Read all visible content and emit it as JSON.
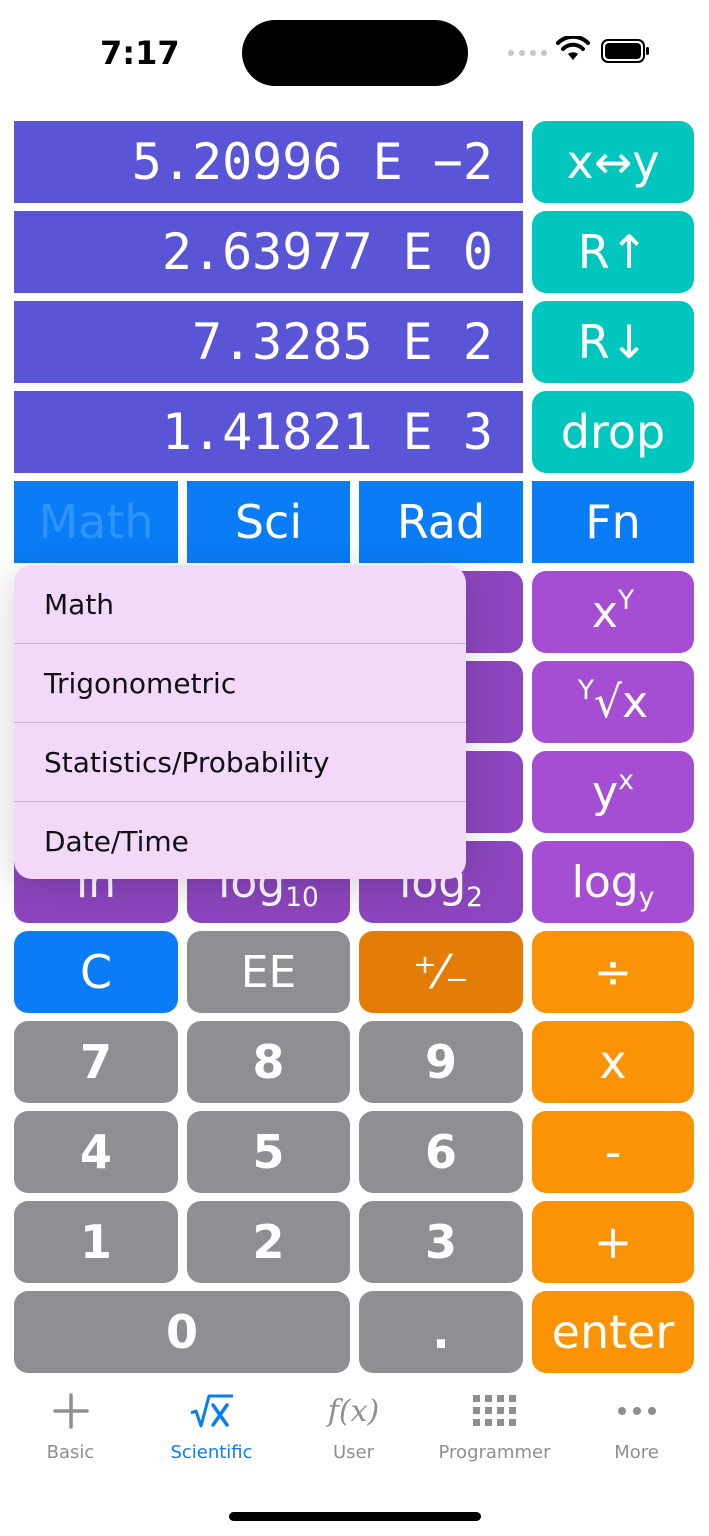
{
  "status": {
    "time": "7:17"
  },
  "stack": [
    "5.20996 E −2",
    "2.63977 E 0",
    "7.3285 E 2",
    "1.41821 E 3"
  ],
  "stack_buttons": [
    "x↔y",
    "R↑",
    "R↓",
    "drop"
  ],
  "modes": [
    "Math",
    "Sci",
    "Rad",
    "Fn"
  ],
  "func_right": {
    "pow_base": "x",
    "pow_exp": "Y",
    "root_index": "Y",
    "root_radicand": "x",
    "ypow_base": "y",
    "ypow_exp": "x",
    "logy_base": "log",
    "logy_sub": "y"
  },
  "func_bottom": {
    "ln": "ln",
    "log10_base": "log",
    "log10_sub": "10",
    "log2_base": "log",
    "log2_sub": "2"
  },
  "keys": {
    "c": "C",
    "ee": "EE",
    "plusminus": "⁺⁄₋",
    "divide": "÷",
    "seven": "7",
    "eight": "8",
    "nine": "9",
    "multiply": "x",
    "four": "4",
    "five": "5",
    "six": "6",
    "minus": "-",
    "one": "1",
    "two": "2",
    "three": "3",
    "plus": "+",
    "zero": "0",
    "dot": ".",
    "enter": "enter"
  },
  "menu": [
    "Math",
    "Trigonometric",
    "Statistics/Probability",
    "Date/Time"
  ],
  "tabs": [
    {
      "label": "Basic",
      "icon": "plus-icon"
    },
    {
      "label": "Scientific",
      "icon": "sqrt-x-icon",
      "active": true
    },
    {
      "label": "User",
      "icon": "fx-icon"
    },
    {
      "label": "Programmer",
      "icon": "grid-icon"
    },
    {
      "label": "More",
      "icon": "ellipsis-icon"
    }
  ],
  "colors": {
    "display": "#5a55d6",
    "teal": "#00c6bd",
    "blue": "#0a7cf6",
    "purple": "#a54ed4",
    "gray": "#8e8e93",
    "orange": "#fb9306"
  }
}
